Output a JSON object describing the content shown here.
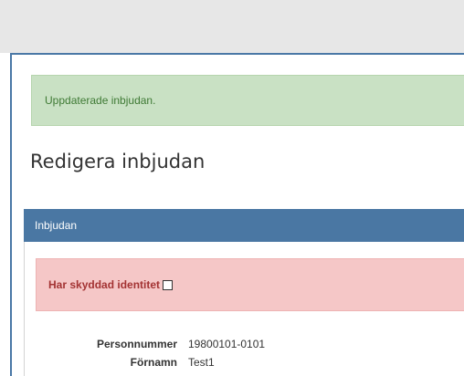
{
  "alert_success": {
    "text": "Uppdaterade inbjudan."
  },
  "page": {
    "title": "Redigera inbjudan"
  },
  "panel": {
    "heading": "Inbjudan",
    "protected_identity": {
      "label": "Har skyddad identitet",
      "checked": false
    },
    "fields": [
      {
        "label": "Personnummer",
        "value": "19800101-0101"
      },
      {
        "label": "Förnamn",
        "value": "Test1"
      }
    ]
  },
  "colors": {
    "panel_heading": "#4a77a3",
    "success_bg": "#c9e1c4",
    "success_text": "#3f7a35",
    "danger_bg": "#f5c7c7",
    "danger_text": "#a33333"
  }
}
